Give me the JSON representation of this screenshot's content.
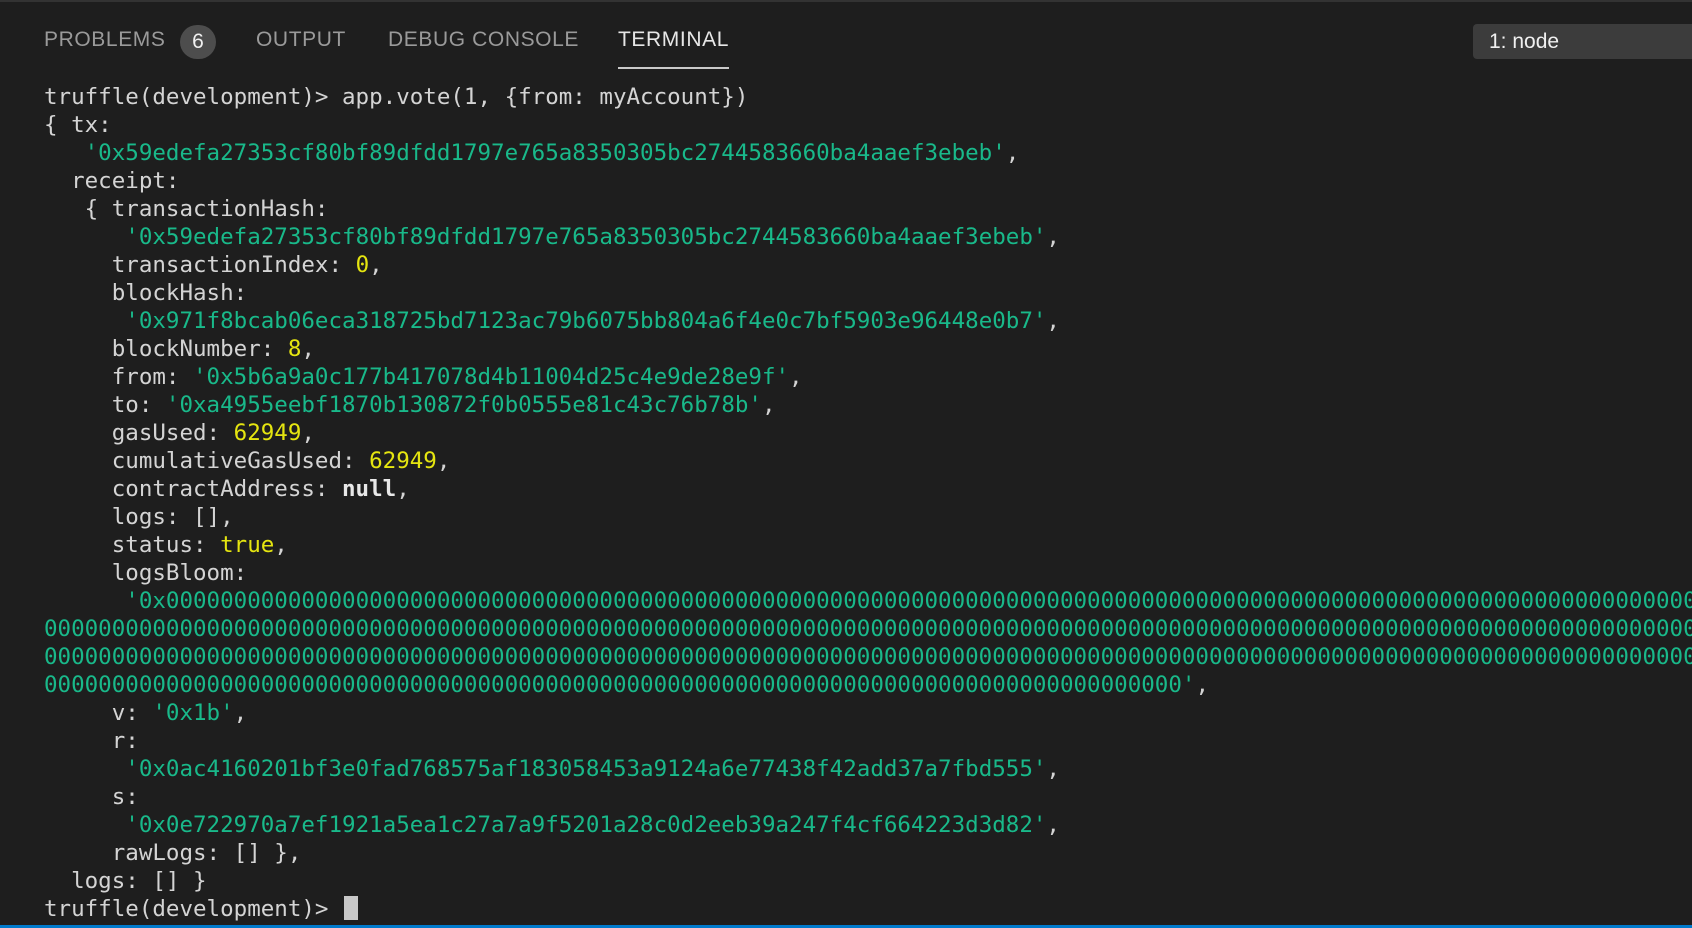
{
  "tabs": {
    "problems": "PROBLEMS",
    "problems_count": "6",
    "output": "OUTPUT",
    "debug_console": "DEBUG CONSOLE",
    "terminal": "TERMINAL"
  },
  "terminal_select": "1: node",
  "terminal": {
    "prompt": "truffle(development)> ",
    "command": "app.vote(1, {from: myAccount})",
    "l_tx": "{ tx:",
    "tx_hash": "'0x59edefa27353cf80bf89dfdd1797e765a8350305bc2744583660ba4aaef3ebeb'",
    "comma": ",",
    "l_receipt": "  receipt:",
    "l_txhash_key": "   { transactionHash:",
    "l_txindex_key": "     transactionIndex: ",
    "tx_index": "0",
    "l_blockhash_key": "     blockHash:",
    "block_hash": "'0x971f8bcab06eca318725bd7123ac79b6075bb804a6f4e0c7bf5903e96448e0b7'",
    "l_blocknum_key": "     blockNumber: ",
    "block_number": "8",
    "l_from_key": "     from: ",
    "from": "'0x5b6a9a0c177b417078d4b11004d25c4e9de28e9f'",
    "l_to_key": "     to: ",
    "to": "'0xa4955eebf1870b130872f0b0555e81c43c76b78b'",
    "l_gasused_key": "     gasUsed: ",
    "gas_used": "62949",
    "l_cumgas_key": "     cumulativeGasUsed: ",
    "cumulative_gas_used": "62949",
    "l_contract_key": "     contractAddress: ",
    "contract_address": "null",
    "l_logs_inner": "     logs: [],",
    "l_status_key": "     status: ",
    "status": "true",
    "l_logsbloom_key": "     logsBloom:",
    "logs_bloom_1": "'0x000000000000000000000000000000000000000000000000000000000000000000000000000000000000000000000000000000000000000000000000000000",
    "logs_bloom_2": "00000000000000000000000000000000000000000000000000000000000000000000000000000000000000000000000000000000000000000000000000000000000000000",
    "logs_bloom_3": "00000000000000000000000000000000000000000000000000000000000000000000000000000000000000000000000000000000000000000000000000000000000000000",
    "logs_bloom_4": "000000000000000000000000000000000000000000000000000000000000000000000000000000000000'",
    "l_v_key": "     v: ",
    "v": "'0x1b'",
    "l_r_key": "     r:",
    "r": "'0x0ac4160201bf3e0fad768575af183058453a9124a6e77438f42add37a7fbd555'",
    "l_s_key": "     s:",
    "s": "'0x0e722970a7ef1921a5ea1c27a7a9f5201a28c0d2eeb39a247f4cf664223d3d82'",
    "l_rawlogs": "     rawLogs: [] },",
    "l_logs_outer": "  logs: [] }"
  }
}
